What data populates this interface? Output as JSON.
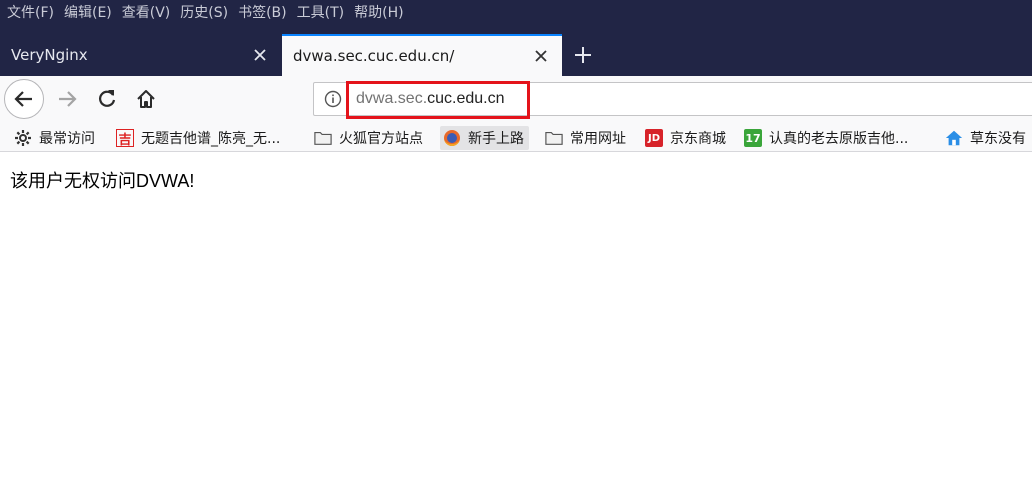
{
  "menubar": {
    "items": [
      "文件(F)",
      "编辑(E)",
      "查看(V)",
      "历史(S)",
      "书签(B)",
      "工具(T)",
      "帮助(H)"
    ]
  },
  "tabs": [
    {
      "title": "VeryNginx",
      "active": false
    },
    {
      "title": "dvwa.sec.cuc.edu.cn/",
      "active": true
    }
  ],
  "urlbar": {
    "host_prefix": "dvwa.sec.",
    "host_domain": "cuc.edu.cn",
    "highlight_color": "#e4131b"
  },
  "bookmarks": [
    {
      "label": "最常访问",
      "icon": "gear-icon"
    },
    {
      "label": "无题吉他谱_陈亮_无...",
      "icon": "ji-site-icon",
      "glyph": "吉"
    },
    {
      "label": "火狐官方站点",
      "icon": "folder-icon"
    },
    {
      "label": "新手上路",
      "icon": "firefox-icon"
    },
    {
      "label": "常用网址",
      "icon": "folder-icon"
    },
    {
      "label": "京东商城",
      "icon": "jd-icon",
      "glyph": "JD"
    },
    {
      "label": "认真的老去原版吉他...",
      "icon": "17-site-icon",
      "glyph": "17"
    },
    {
      "label": "草东没有",
      "icon": "house-icon"
    }
  ],
  "page": {
    "message": "该用户无权访问DVWA!"
  },
  "colors": {
    "chrome_dark": "#212545",
    "toolbar": "#f9f9fa",
    "active_tab_accent": "#0a84ff"
  }
}
